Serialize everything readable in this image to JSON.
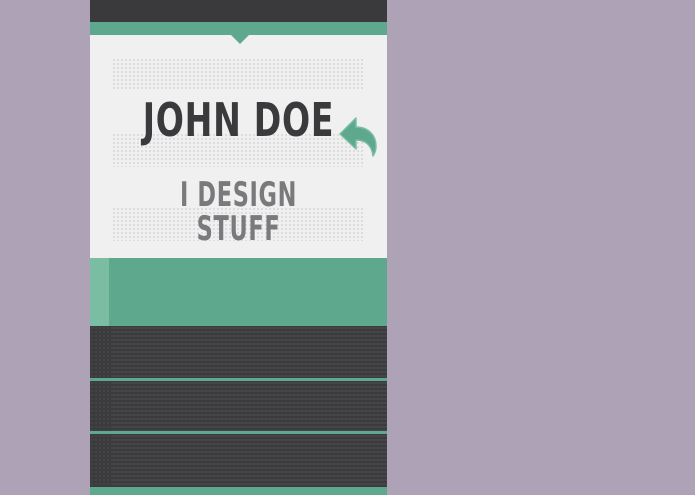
{
  "profile": {
    "name": "JOHN DOE",
    "tagline": "I DESIGN STUFF"
  },
  "icons": {
    "back": "reply-arrow-icon"
  },
  "colors": {
    "accent": "#5ea88d",
    "accent_light": "#7bbda3",
    "panel_dark": "#3b3b3d",
    "card_bg": "#f0f0f1",
    "page_bg": "#aea2b7",
    "name_text": "#3a3a3c",
    "tagline_text": "#7a7a7c"
  },
  "menu": {
    "items": [
      {
        "label": ""
      },
      {
        "label": ""
      },
      {
        "label": ""
      }
    ]
  }
}
